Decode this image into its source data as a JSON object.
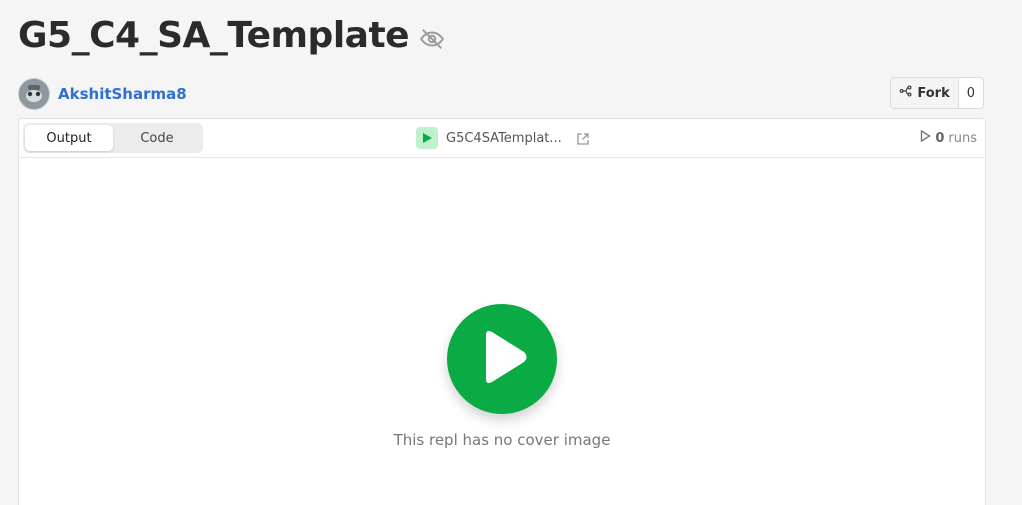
{
  "title": "G5_C4_SA_Template",
  "visibility_icon": "eye-slash-icon",
  "author": {
    "name": "AkshitSharma8",
    "avatar_icon": "avatar-icon"
  },
  "fork": {
    "label": "Fork",
    "count": "0",
    "icon": "fork-icon"
  },
  "tabs": [
    {
      "label": "Output",
      "active": true
    },
    {
      "label": "Code",
      "active": false
    }
  ],
  "repl": {
    "name": "G5C4SATemplat...",
    "run_icon": "play-icon",
    "link_icon": "external-link-icon"
  },
  "runs": {
    "count": "0",
    "label": "runs",
    "icon": "play-outline-icon"
  },
  "cover": {
    "text": "This repl has no cover image",
    "play_icon": "play-icon"
  },
  "colors": {
    "accent_green": "#0aab45",
    "link_blue": "#2f6fd4"
  }
}
